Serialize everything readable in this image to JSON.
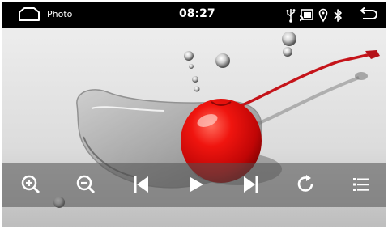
{
  "status_bar": {
    "app_name": "Photo",
    "time": "08:27",
    "icons": [
      "home-icon",
      "usb-icon",
      "cast-icon",
      "location-icon",
      "bluetooth-icon",
      "back-icon"
    ]
  },
  "photo": {
    "subject": "red-cherry-with-water-drops",
    "colors": {
      "background": "#e7e7e7",
      "cherry": "#e00b0b",
      "stem": "#c5141a"
    }
  },
  "controls": {
    "items": [
      "zoom-in-icon",
      "zoom-out-icon",
      "previous-icon",
      "play-icon",
      "next-icon",
      "rotate-icon",
      "list-icon"
    ]
  }
}
